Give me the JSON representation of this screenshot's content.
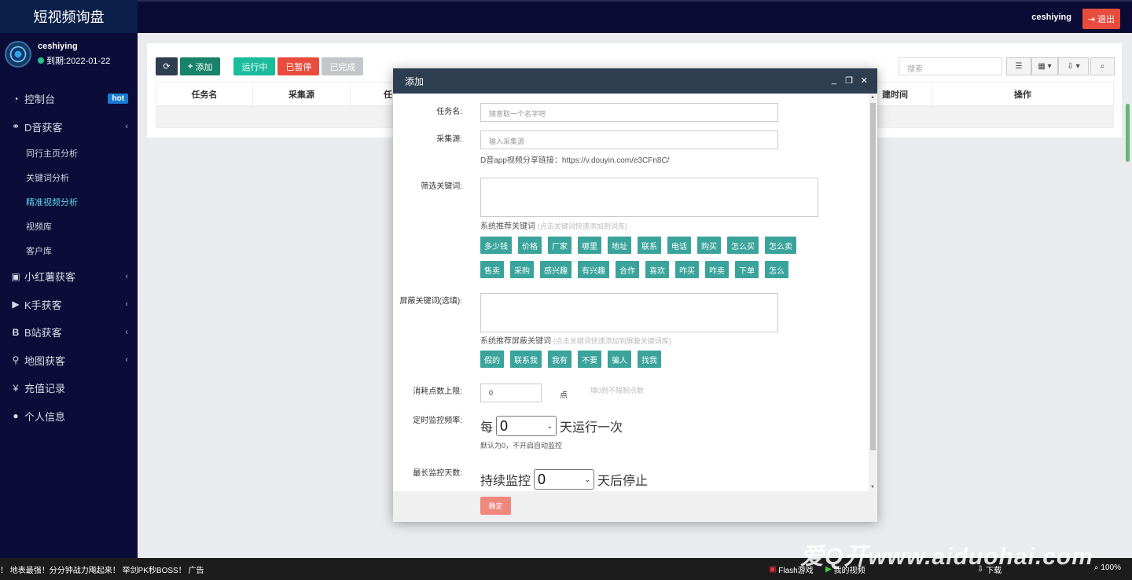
{
  "app": {
    "title": "短视频询盘"
  },
  "user": {
    "name": "ceshiying",
    "expire": "到期:2022-01-22"
  },
  "topbar": {
    "user": "ceshiying",
    "logout": "退出"
  },
  "sidebar": {
    "items": [
      {
        "label": "控制台",
        "icon": "dashboard-icon",
        "badge": "hot"
      },
      {
        "label": "D音获客",
        "icon": "handshake-icon"
      },
      {
        "label": "小红薯获客",
        "icon": "book-icon"
      },
      {
        "label": "K手获客",
        "icon": "play-circle-icon"
      },
      {
        "label": "B站获客",
        "icon": "bold-b-icon"
      },
      {
        "label": "地图获客",
        "icon": "map-marker-icon"
      },
      {
        "label": "充值记录",
        "icon": "yen-icon"
      },
      {
        "label": "个人信息",
        "icon": "user-icon"
      }
    ],
    "sub_items": [
      "同行主页分析",
      "关键词分析",
      "精准视频分析",
      "视频库",
      "客户库"
    ]
  },
  "toolbar": {
    "add": "添加",
    "running": "运行中",
    "paused": "已暂停",
    "done": "已完成",
    "search_placeholder": "搜索"
  },
  "table": {
    "headers": [
      "任务名",
      "采集源",
      "任",
      "建时间",
      "操作"
    ]
  },
  "modal": {
    "title": "添加",
    "task_name_label": "任务名:",
    "task_name_placeholder": "随意取一个名字吧",
    "source_label": "采集源:",
    "source_placeholder": "输入采集源",
    "source_hint": "D音app视频分享链接：https://v.douyin.com/e3CFn8C/",
    "filter_label": "筛选关键词:",
    "filter_suggest": "系统推荐关键词",
    "filter_suggest_tip": "(点击关键词快速添加到词库)",
    "filter_keywords": [
      "多少钱",
      "价格",
      "厂家",
      "哪里",
      "地址",
      "联系",
      "电话",
      "购买",
      "怎么买",
      "怎么卖",
      "售卖",
      "采购",
      "感兴趣",
      "有兴趣",
      "合作",
      "喜欢",
      "咋买",
      "咋卖",
      "下单",
      "怎么"
    ],
    "block_label": "屏蔽关键词(选填):",
    "block_suggest": "系统推荐屏蔽关键词",
    "block_suggest_tip": "(点击关键词快速添加到屏蔽关键词库)",
    "block_keywords": [
      "假的",
      "联系我",
      "我有",
      "不要",
      "骗人",
      "找我"
    ],
    "points_label": "消耗点数上限:",
    "points_value": "0",
    "points_unit": "点",
    "points_hint": "填0则不限制点数",
    "freq_label": "定时监控频率:",
    "freq_prefix": "每",
    "freq_value": "0",
    "freq_suffix": "天运行一次",
    "freq_hint": "默认为0，不开启自动监控",
    "maxdays_label": "最长监控天数:",
    "maxdays_prefix": "持续监控",
    "maxdays_value": "0",
    "maxdays_suffix": "天后停止",
    "ok": "确定"
  },
  "taskbar": {
    "ticker": "！ 地表最强！分分钟战力飚起来！ 举剑PK秒BOSS！",
    "ticker_tag": "广告",
    "flash": "Flash游戏",
    "video": "我的视频",
    "download": "下载",
    "zoom": "100%"
  },
  "watermark": "爱Q开www.aiduohai.com"
}
